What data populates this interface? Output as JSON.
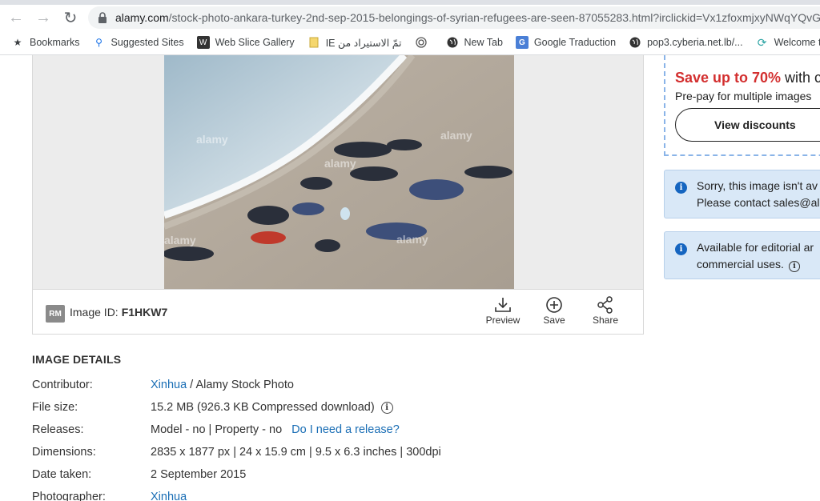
{
  "browser": {
    "url_host": "alamy.com",
    "url_path": "/stock-photo-ankara-turkey-2nd-sep-2015-belongings-of-syrian-refugees-are-seen-87055283.html?irclickid=Vx1zfoxmjxyNWqYQvG"
  },
  "bookmarks": [
    {
      "label": "Bookmarks",
      "icon": "star-icon"
    },
    {
      "label": "Suggested Sites",
      "icon": "search-icon"
    },
    {
      "label": "Web Slice Gallery",
      "icon": "webslice-icon"
    },
    {
      "label": "IE تمّ الاستيراد من",
      "icon": "folder-icon"
    },
    {
      "label": "",
      "icon": "target-icon"
    },
    {
      "label": "New Tab",
      "icon": "globe-icon"
    },
    {
      "label": "Google Traduction",
      "icon": "translate-icon"
    },
    {
      "label": "pop3.cyberia.net.lb/...",
      "icon": "globe-icon"
    },
    {
      "label": "Welcome to RAPID",
      "icon": "rapid-icon"
    }
  ],
  "image": {
    "rights_badge": "RM",
    "id_label": "Image ID:",
    "id_value": "F1HKW7",
    "actions": {
      "preview": "Preview",
      "save": "Save",
      "share": "Share"
    }
  },
  "details": {
    "heading": "IMAGE DETAILS",
    "contributor_label": "Contributor:",
    "contributor_link": "Xinhua",
    "contributor_suffix": " / Alamy Stock Photo",
    "filesize_label": "File size:",
    "filesize_value": "15.2 MB (926.3 KB Compressed download)",
    "releases_label": "Releases:",
    "releases_value": "Model - no | Property - no",
    "releases_link": "Do I need a release?",
    "dimensions_label": "Dimensions:",
    "dimensions_value": "2835 x 1877 px | 24 x 15.9 cm | 9.5 x 6.3 inches | 300dpi",
    "date_label": "Date taken:",
    "date_value": "2 September 2015",
    "photographer_label": "Photographer:",
    "photographer_link": "Xinhua"
  },
  "promo": {
    "save_red": "Save up to 70%",
    "save_rest": " with c",
    "sub": "Pre-pay for multiple images",
    "button": "View discounts"
  },
  "notices": {
    "unavailable_line1": "Sorry, this image isn't av",
    "unavailable_line2": "Please contact sales@al",
    "editorial_line1": "Available for editorial ar",
    "editorial_line2": "commercial uses."
  },
  "colors": {
    "link": "#1a6eb5",
    "save_red": "#d32f2f",
    "notice_bg": "#d9e8f7",
    "info_blue": "#1565c0"
  }
}
